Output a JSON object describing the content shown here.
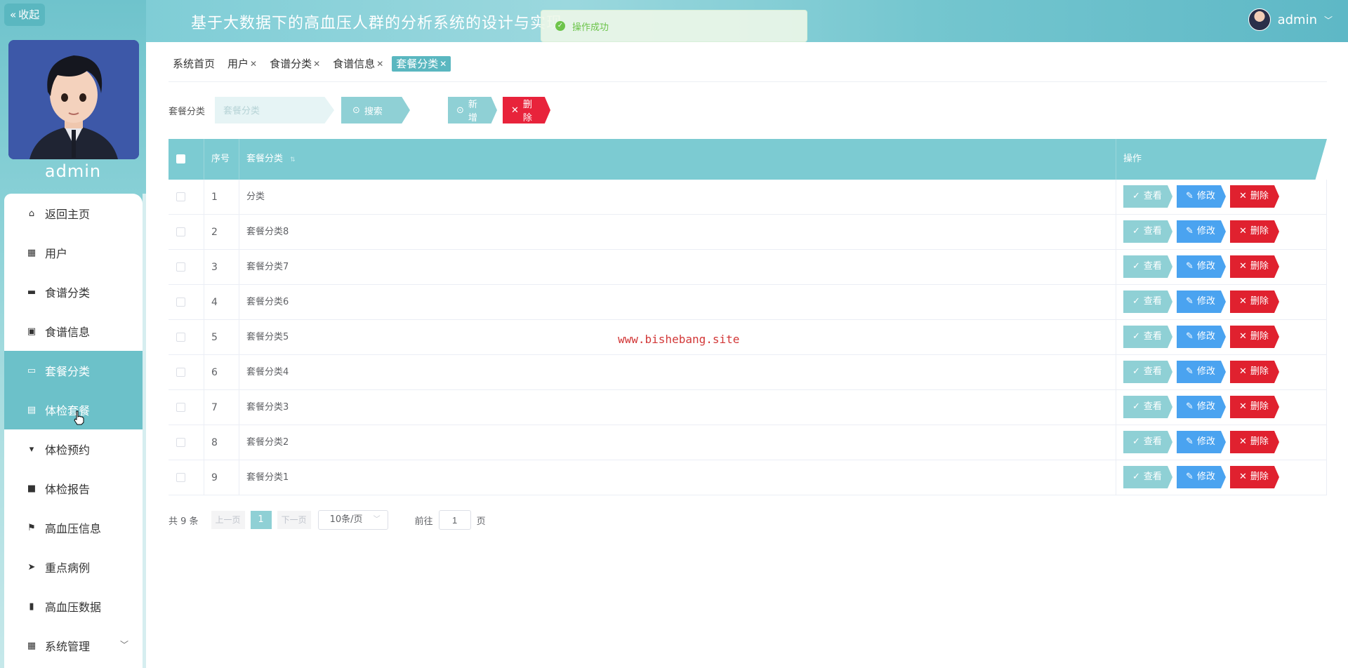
{
  "sidebar": {
    "collapse_label": "收起",
    "username": "admin",
    "menu": [
      {
        "label": "返回主页",
        "icon": "home-icon"
      },
      {
        "label": "用户",
        "icon": "grid-icon"
      },
      {
        "label": "食谱分类",
        "icon": "folder-icon"
      },
      {
        "label": "食谱信息",
        "icon": "clipboard-icon"
      },
      {
        "label": "套餐分类",
        "icon": "ticket-icon"
      },
      {
        "label": "体检套餐",
        "icon": "note-icon"
      },
      {
        "label": "体检预约",
        "icon": "pin-icon"
      },
      {
        "label": "体检报告",
        "icon": "briefcase-icon"
      },
      {
        "label": "高血压信息",
        "icon": "flag-icon"
      },
      {
        "label": "重点病例",
        "icon": "send-icon"
      },
      {
        "label": "高血压数据",
        "icon": "bar-chart-icon"
      },
      {
        "label": "系统管理",
        "icon": "grid-icon"
      }
    ],
    "active_index": 4,
    "hover_index": 5
  },
  "header": {
    "title": "基于大数据下的高血压人群的分析系统的设计与实现",
    "toast": "操作成功",
    "user": "admin"
  },
  "tabs": [
    {
      "label": "系统首页",
      "closable": false
    },
    {
      "label": "用户",
      "closable": true
    },
    {
      "label": "食谱分类",
      "closable": true
    },
    {
      "label": "食谱信息",
      "closable": true
    },
    {
      "label": "套餐分类",
      "closable": true,
      "active": true
    }
  ],
  "search": {
    "label": "套餐分类",
    "placeholder": "套餐分类",
    "search_btn": "搜索",
    "add_btn": "新增",
    "delete_btn": "删除"
  },
  "table": {
    "col_index": "序号",
    "col_name": "套餐分类",
    "col_ops": "操作",
    "view_label": "查看",
    "edit_label": "修改",
    "delete_label": "删除",
    "rows": [
      {
        "index": "1",
        "name": "分类"
      },
      {
        "index": "2",
        "name": "套餐分类8"
      },
      {
        "index": "3",
        "name": "套餐分类7"
      },
      {
        "index": "4",
        "name": "套餐分类6"
      },
      {
        "index": "5",
        "name": "套餐分类5"
      },
      {
        "index": "6",
        "name": "套餐分类4"
      },
      {
        "index": "7",
        "name": "套餐分类3"
      },
      {
        "index": "8",
        "name": "套餐分类2"
      },
      {
        "index": "9",
        "name": "套餐分类1"
      }
    ]
  },
  "pager": {
    "total": "共 9 条",
    "prev": "上一页",
    "current": "1",
    "next": "下一页",
    "page_size": "10条/页",
    "goto": "前往",
    "goto_value": "1",
    "page_unit": "页"
  },
  "watermark": "www.bishebang.site",
  "colors": {
    "accent": "#5ab7c0",
    "light_accent": "#8fd0d5",
    "edit_blue": "#4aa3f0",
    "danger_red": "#e0212f"
  }
}
